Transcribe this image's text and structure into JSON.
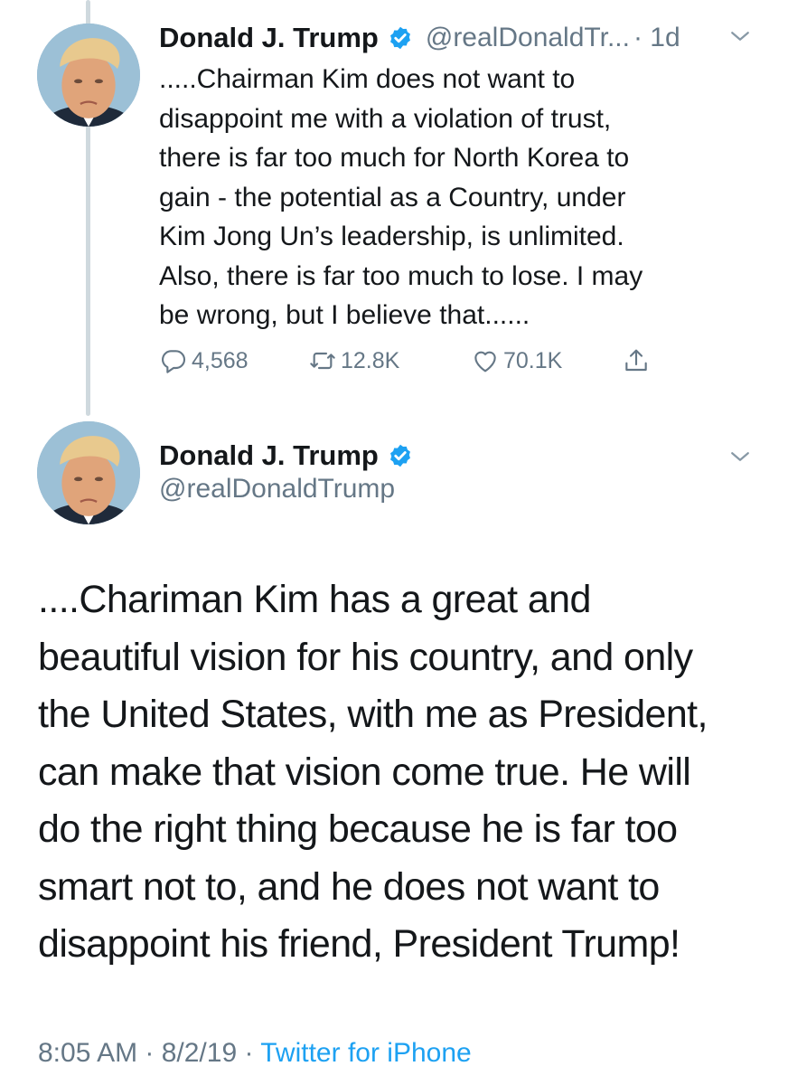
{
  "colors": {
    "text": "#14171a",
    "secondary": "#657786",
    "link": "#1da1f2",
    "verified": "#1da1f2"
  },
  "tweet1": {
    "name": "Donald J. Trump",
    "verified_icon": "verified-badge-icon",
    "handle": "@realDonaldTr...",
    "time": "· 1d",
    "text": ".....Chairman Kim does not want to\ndisappoint me with a violation of trust,\nthere is far too much for North Korea to\ngain - the potential as a Country, under\nKim Jong Un’s leadership, is unlimited.\nAlso, there is far too much to lose. I may\nbe wrong, but I believe that......",
    "replies": "4,568",
    "retweets": "12.8K",
    "likes": "70.1K"
  },
  "tweet2": {
    "name": "Donald J. Trump",
    "handle": "@realDonaldTrump",
    "text": "....Chariman Kim has a great and\nbeautiful vision for his country, and only\nthe United States, with me as President,\ncan make that vision come true. He will\ndo the right thing because he is far too\nsmart not to, and he does not want to\ndisappoint his friend, President Trump!",
    "timestamp": "8:05 AM · 8/2/19 · ",
    "source": "Twitter for iPhone"
  }
}
